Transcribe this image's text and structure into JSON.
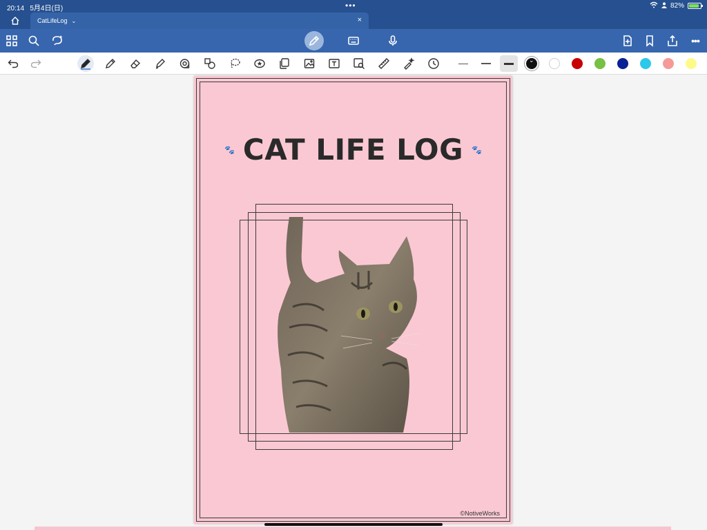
{
  "status_bar": {
    "time": "20:14",
    "date": "5月4日(日)",
    "battery": "82%"
  },
  "tabs": {
    "home_icon": "house-icon",
    "active": {
      "label": "CatLifeLog",
      "chevron": "⌄",
      "close": "×"
    }
  },
  "app_bar": {
    "left_icons": [
      "grid-icon",
      "search-icon",
      "lasso-sparkle-icon"
    ],
    "modes": [
      "pen-mode-icon",
      "keyboard-icon",
      "microphone-icon"
    ],
    "right_icons": [
      "add-page-icon",
      "bookmark-icon",
      "share-icon",
      "more-icon"
    ],
    "more_glyph": "•••"
  },
  "toolbar": {
    "undo": "undo-icon",
    "redo": "redo-icon",
    "tools": [
      "pen-icon",
      "pencil-icon",
      "eraser-icon",
      "highlighter-icon",
      "tape-icon",
      "shapes-icon",
      "lasso-icon",
      "sticker-icon",
      "elements-icon",
      "image-icon",
      "text-icon",
      "scan-icon",
      "ruler-icon",
      "laser-icon",
      "timer-icon"
    ],
    "thickness": [
      "thin",
      "medium",
      "thick"
    ],
    "selected_thickness": "thick",
    "colors": [
      "#111111",
      "#ffffff",
      "#c80000",
      "#76c043",
      "#0a2196",
      "#2cc8ea",
      "#f59a99",
      "#fdfa8a"
    ],
    "selected_color": "#111111"
  },
  "page": {
    "background": "#fac8d3",
    "title": "CAT LIFE LOG",
    "paw": "🐾",
    "copyright": "©NotiveWorks"
  }
}
